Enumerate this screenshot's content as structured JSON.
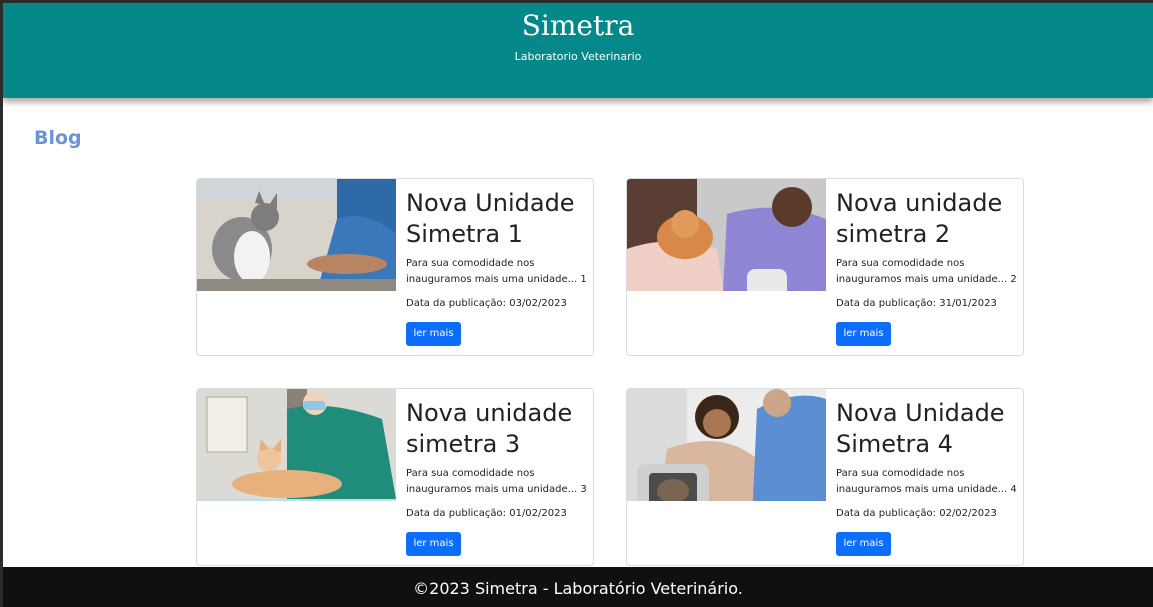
{
  "header": {
    "title": "Simetra",
    "subtitle": "Laboratorio Veterinario"
  },
  "blog": {
    "heading": "Blog",
    "posts": [
      {
        "title": "Nova Unidade Simetra 1",
        "excerpt": "Para sua comodidade nos inauguramos mais uma unidade... 1",
        "date": "Data da publicação: 03/02/2023",
        "button_label": "ler mais",
        "image_icon": "cat-vet-photo"
      },
      {
        "title": "Nova unidade simetra 2",
        "excerpt": "Para sua comodidade nos inauguramos mais uma unidade... 2",
        "date": "Data da publicação: 31/01/2023",
        "button_label": "ler mais",
        "image_icon": "cat-hug-vet-photo"
      },
      {
        "title": "Nova unidade simetra 3",
        "excerpt": "Para sua comodidade nos inauguramos mais uma unidade... 3",
        "date": "Data da publicação: 01/02/2023",
        "button_label": "ler mais",
        "image_icon": "cat-exam-photo"
      },
      {
        "title": "Nova Unidade Simetra 4",
        "excerpt": "Para sua comodidade nos inauguramos mais uma unidade... 4",
        "date": "Data da publicação: 02/02/2023",
        "button_label": "ler mais",
        "image_icon": "cat-carrier-photo"
      }
    ]
  },
  "footer": {
    "text": "©2023 Simetra - Laboratório Veterinário."
  },
  "colors": {
    "header_bg": "#05888a",
    "blog_heading": "#6a93d8",
    "button_bg": "#0d6efd",
    "footer_bg": "#101010"
  }
}
